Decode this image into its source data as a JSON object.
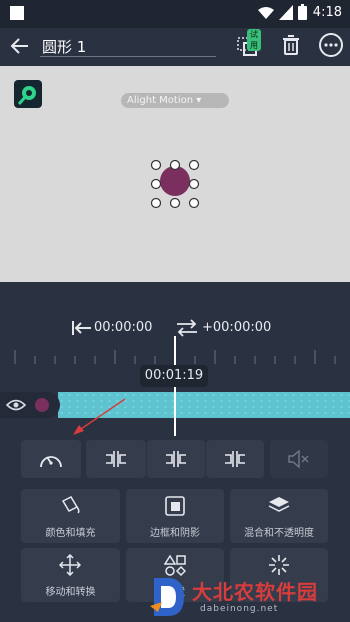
{
  "status_bar": {
    "time": "4:18"
  },
  "app_bar": {
    "title": "圆形 1",
    "trial_badge": "试用"
  },
  "canvas": {
    "watermark": "Alight Motion ▾"
  },
  "timeline": {
    "start_time": "00:00:00",
    "offset_time": "+00:00:00",
    "current_time": "00:01:19"
  },
  "tools": {
    "color_fill": "颜色和填充",
    "border_shadow": "边框和阴影",
    "blend_opacity": "混合和不透明度",
    "move_transform": "移动和转换",
    "shape": "形状"
  },
  "site_watermark": {
    "name": "大北农软件园",
    "url": "dabeinong.net"
  },
  "colors": {
    "accent": "#5fc3cf",
    "shape_fill": "#7a2f5e",
    "bg": "#2a3140"
  }
}
